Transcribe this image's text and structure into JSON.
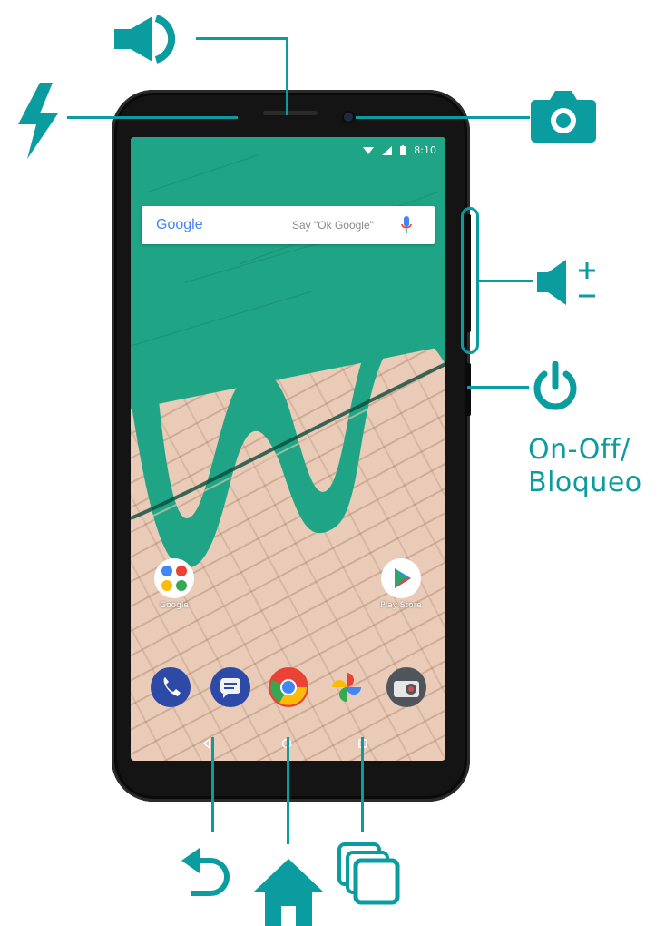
{
  "callouts": {
    "power_label_line1": "On-Off/",
    "power_label_line2": "Bloqueo"
  },
  "status_bar": {
    "time": "8:10",
    "icons": [
      "wifi-icon",
      "signal-icon",
      "battery-icon"
    ]
  },
  "search_widget": {
    "logo": "Google",
    "hint": "Say \"Ok Google\"",
    "icon": "mic-icon"
  },
  "home_apps": [
    {
      "label": "Google",
      "icon": "google-folder-icon"
    },
    {
      "label": "Play Store",
      "icon": "play-store-icon"
    }
  ],
  "dock_apps": [
    "phone-icon",
    "messages-icon",
    "chrome-icon",
    "photos-icon",
    "camera-icon"
  ],
  "colors": {
    "accent": "#0b9ca0",
    "wallpaper_green": "#1fa585",
    "brick": "#e9cbb7"
  }
}
